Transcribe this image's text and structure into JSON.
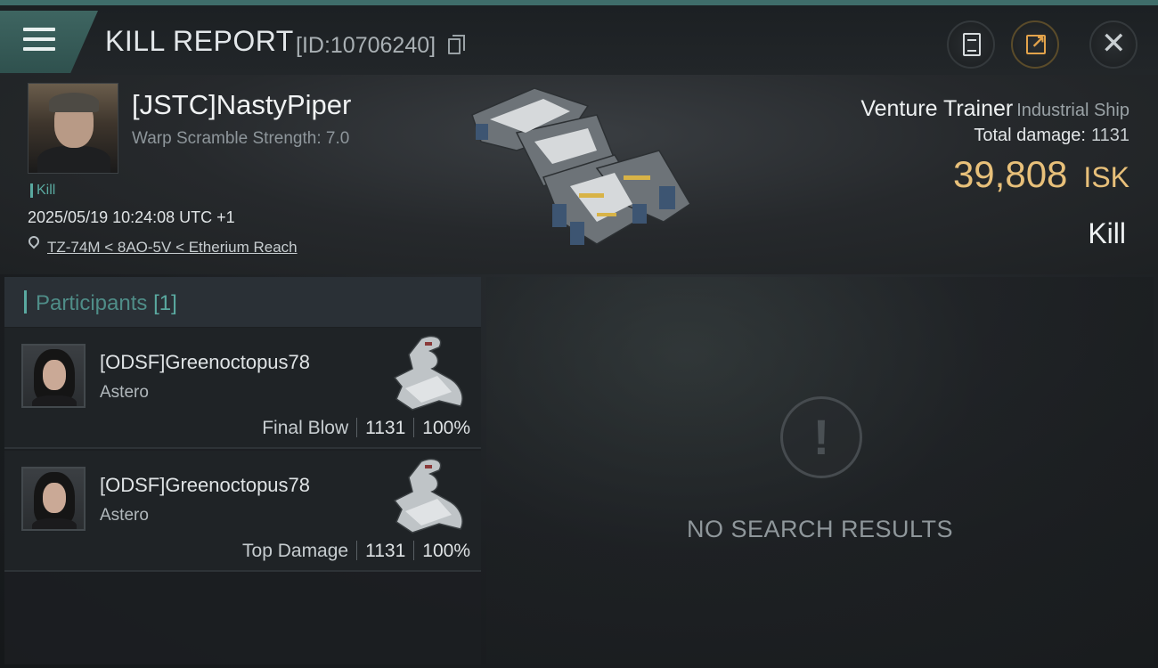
{
  "header": {
    "title": "KILL REPORT",
    "report_id": "[ID:10706240]"
  },
  "victim": {
    "pilot": "[JSTC]NastyPiper",
    "warp_scramble": "Warp Scramble Strength: 7.0",
    "tag": "Kill",
    "datetime": "2025/05/19 10:24:08 UTC +1",
    "location": "TZ-74M < 8AO-5V < Etherium Reach",
    "ship_name": "Venture Trainer",
    "ship_class": "Industrial Ship",
    "total_damage_label": "Total damage:",
    "total_damage_value": "1131",
    "isk_value": "39,808",
    "isk_unit": "ISK",
    "result": "Kill"
  },
  "participants": {
    "label": "Participants",
    "count": "[1]",
    "rows": [
      {
        "name": "[ODSF]Greenoctopus78",
        "ship": "Astero",
        "role": "Final Blow",
        "damage": "1131",
        "percent": "100%"
      },
      {
        "name": "[ODSF]Greenoctopus78",
        "ship": "Astero",
        "role": "Top Damage",
        "damage": "1131",
        "percent": "100%"
      }
    ]
  },
  "empty_state": {
    "text": "NO SEARCH RESULTS"
  },
  "icons": {
    "menu": "menu-icon",
    "copy": "copy-icon",
    "clipboard": "clipboard-icon",
    "share": "share-icon",
    "close": "close-icon",
    "location": "location-pin-icon",
    "alert": "exclamation-icon"
  },
  "colors": {
    "accent_teal": "#5aa9a0",
    "isk_gold": "#e8c07a"
  }
}
